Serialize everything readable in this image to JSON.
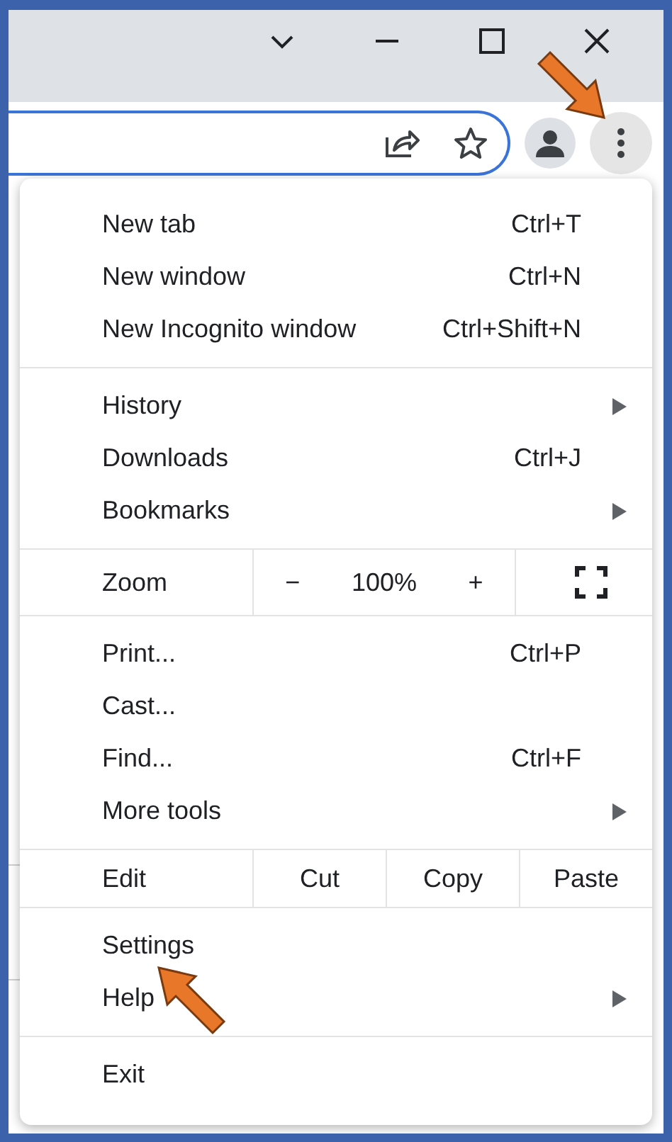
{
  "menu": {
    "sections": [
      {
        "items": [
          {
            "kind": "item",
            "label": "New tab",
            "shortcut": "Ctrl+T",
            "has_submenu": false
          },
          {
            "kind": "item",
            "label": "New window",
            "shortcut": "Ctrl+N",
            "has_submenu": false
          },
          {
            "kind": "item",
            "label": "New Incognito window",
            "shortcut": "Ctrl+Shift+N",
            "has_submenu": false
          }
        ]
      },
      {
        "items": [
          {
            "kind": "item",
            "label": "History",
            "has_submenu": true
          },
          {
            "kind": "item",
            "label": "Downloads",
            "shortcut": "Ctrl+J",
            "has_submenu": false
          },
          {
            "kind": "item",
            "label": "Bookmarks",
            "has_submenu": true
          }
        ]
      },
      {
        "items": [
          {
            "kind": "zoom",
            "label": "Zoom",
            "minus": "−",
            "value": "100%",
            "plus": "+"
          }
        ]
      },
      {
        "items": [
          {
            "kind": "item",
            "label": "Print...",
            "shortcut": "Ctrl+P",
            "has_submenu": false
          },
          {
            "kind": "item",
            "label": "Cast...",
            "has_submenu": false
          },
          {
            "kind": "item",
            "label": "Find...",
            "shortcut": "Ctrl+F",
            "has_submenu": false
          },
          {
            "kind": "item",
            "label": "More tools",
            "has_submenu": true
          }
        ]
      },
      {
        "items": [
          {
            "kind": "edit",
            "label": "Edit",
            "buttons": [
              "Cut",
              "Copy",
              "Paste"
            ]
          }
        ]
      },
      {
        "items": [
          {
            "kind": "item",
            "label": "Settings",
            "has_submenu": false
          },
          {
            "kind": "item",
            "label": "Help",
            "has_submenu": true
          }
        ]
      },
      {
        "items": [
          {
            "kind": "item",
            "label": "Exit",
            "has_submenu": false
          }
        ]
      }
    ]
  }
}
